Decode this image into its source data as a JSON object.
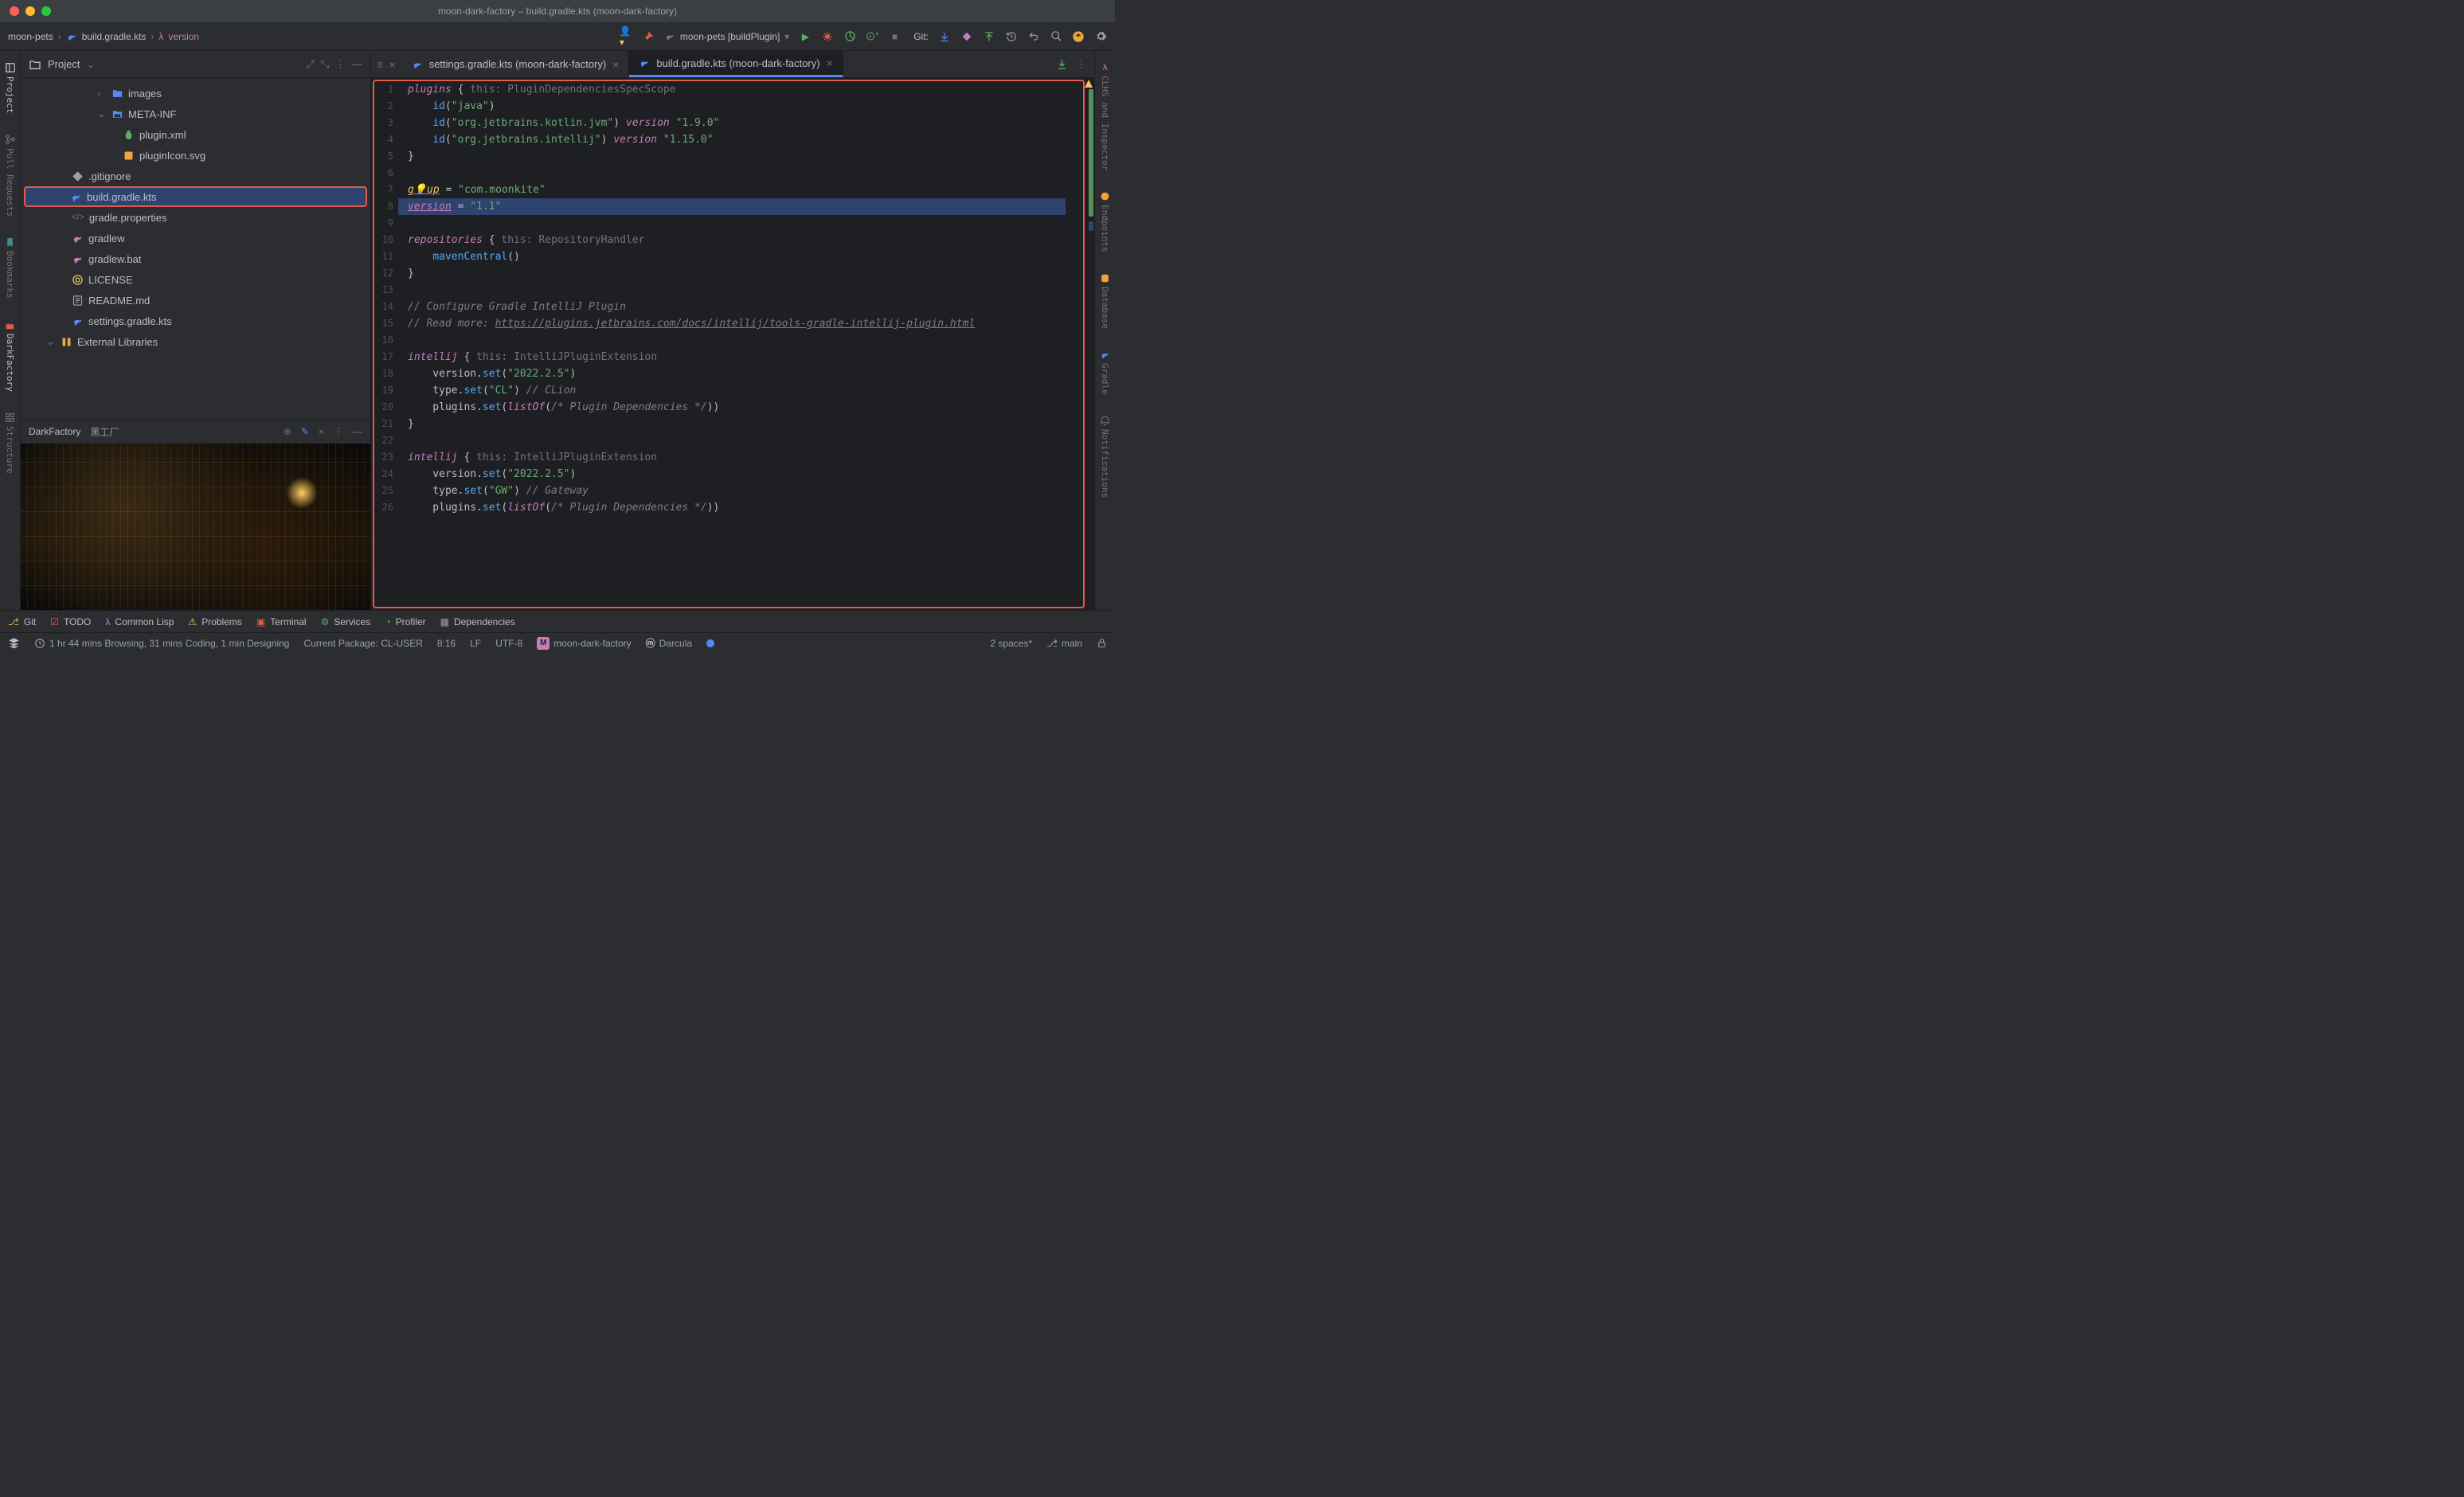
{
  "titlebar": {
    "title": "moon-dark-factory – build.gradle.kts (moon-dark-factory)"
  },
  "breadcrumb": {
    "root": "moon-pets",
    "file": "build.gradle.kts",
    "symbol": "version"
  },
  "run_config": {
    "label": "moon-pets [buildPlugin]"
  },
  "git_label": "Git:",
  "left_gutter": {
    "project": "Project",
    "pull_requests": "Pull Requests",
    "bookmarks": "Bookmarks",
    "darkfactory": "DarkFactory",
    "structure": "Structure"
  },
  "right_gutter": {
    "clhs": "CLHS and Inspector",
    "endpoints": "Endpoints",
    "database": "Database",
    "gradle": "Gradle",
    "notifications": "Notifications"
  },
  "sidebar": {
    "title": "Project",
    "tree": {
      "images": "images",
      "metainf": "META-INF",
      "pluginxml": "plugin.xml",
      "pluginicon": "pluginIcon.svg",
      "gitignore": ".gitignore",
      "buildgradle": "build.gradle.kts",
      "gradleprops": "gradle.properties",
      "gradlew": "gradlew",
      "gradlewbat": "gradlew.bat",
      "license": "LICENSE",
      "readme": "README.md",
      "settingsgradle": "settings.gradle.kts",
      "extlib": "External Libraries"
    },
    "df": {
      "title1": "DarkFactory",
      "title2": "黑工厂"
    }
  },
  "tabs": {
    "partial_label": "s",
    "settings": "settings.gradle.kts (moon-dark-factory)",
    "build": "build.gradle.kts (moon-dark-factory)"
  },
  "code": {
    "lines": [
      "1",
      "2",
      "3",
      "4",
      "5",
      "6",
      "7",
      "8",
      "9",
      "10",
      "11",
      "12",
      "13",
      "14",
      "15",
      "16",
      "17",
      "18",
      "19",
      "20",
      "21",
      "22",
      "23",
      "24",
      "25",
      "26"
    ],
    "l1_plugins": "plugins",
    "l1_hint": "this: PluginDependenciesSpecScope",
    "l2_id": "id",
    "l2_java": "\"java\"",
    "l3_kotlin": "\"org.jetbrains.kotlin.jvm\"",
    "l3_version": "version",
    "l3_ver": "\"1.9.0\"",
    "l4_intellij": "\"org.jetbrains.intellij\"",
    "l4_ver": "\"1.15.0\"",
    "l7_group": "group",
    "l7_val": "\"com.moonkite\"",
    "l8_version": "version",
    "l8_val": "\"1.1\"",
    "l10_repos": "repositories",
    "l10_hint": "this: RepositoryHandler",
    "l11_maven": "mavenCentral",
    "l14_com": "// Configure Gradle IntelliJ Plugin",
    "l15_com": "// Read more: ",
    "l15_url": "https://plugins.jetbrains.com/docs/intellij/tools-gradle-intellij-plugin.html",
    "l17_intellij": "intellij",
    "l17_hint": "this: IntelliJPluginExtension",
    "l18_ver": "\"2022.2.5\"",
    "l19_type": "\"CL\"",
    "l19_com": "// CLion",
    "l20_listof": "listOf",
    "l20_com": "/* Plugin Dependencies */",
    "l24_ver": "\"2022.2.5\"",
    "l25_type": "\"GW\"",
    "l25_com": "// Gateway"
  },
  "bottom_bar": {
    "git": "Git",
    "todo": "TODO",
    "lisp": "Common Lisp",
    "problems": "Problems",
    "terminal": "Terminal",
    "services": "Services",
    "profiler": "Profiler",
    "deps": "Dependencies"
  },
  "status_bar": {
    "wakatime": "1 hr 44 mins Browsing, 31 mins Coding, 1 min Designing",
    "pkg": "Current Package: CL-USER",
    "pos": "8:16",
    "lf": "LF",
    "enc": "UTF-8",
    "module": "moon-dark-factory",
    "theme": "Darcula",
    "spaces": "2 spaces*",
    "branch": "main"
  }
}
